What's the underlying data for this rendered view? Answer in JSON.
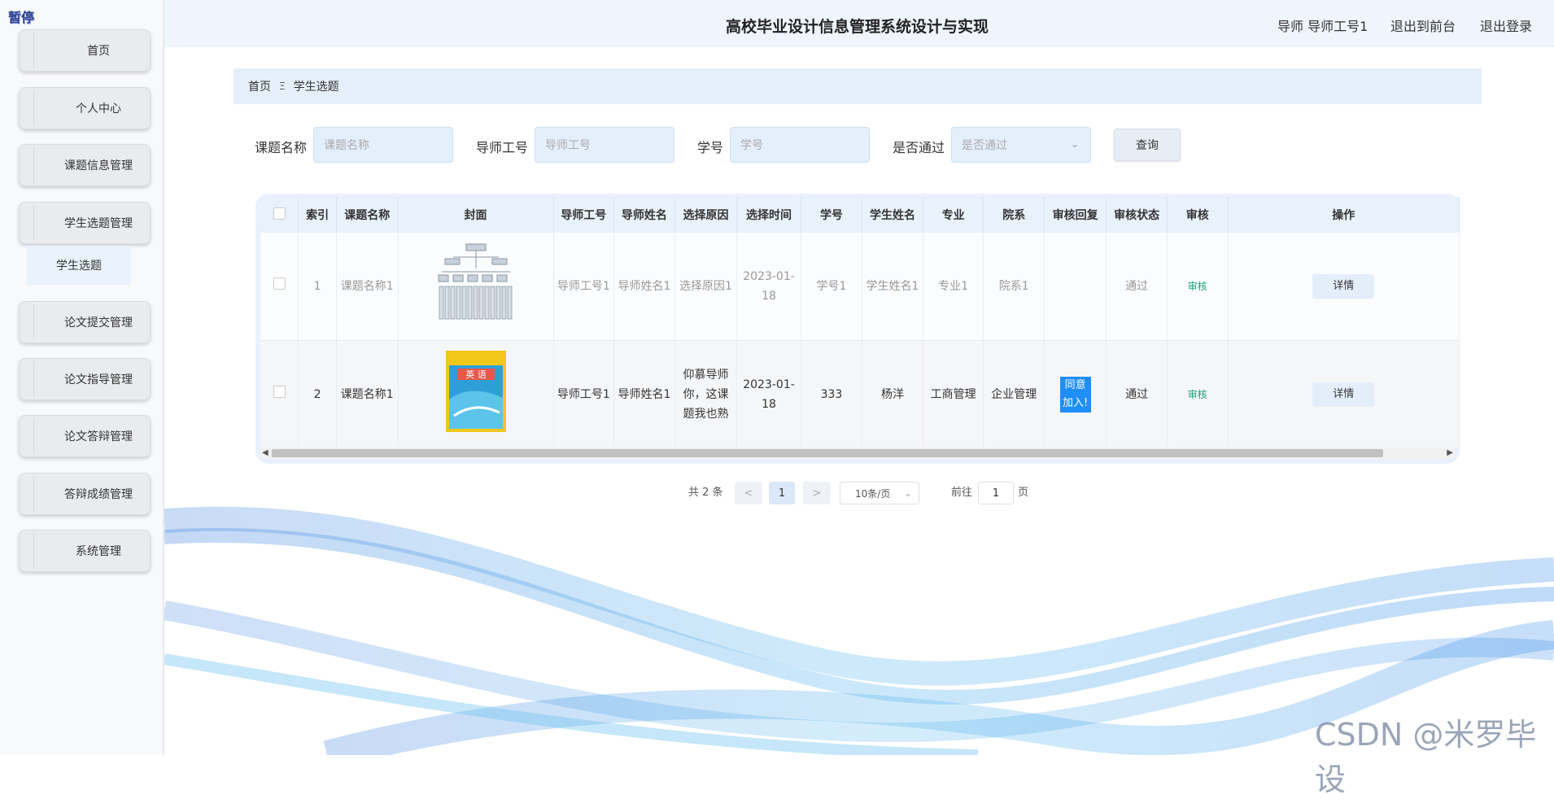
{
  "sidebar": {
    "logo": "暂停",
    "items": [
      {
        "label": "首页"
      },
      {
        "label": "个人中心"
      },
      {
        "label": "课题信息管理"
      },
      {
        "label": "学生选题管理"
      },
      {
        "label": "论文提交管理"
      },
      {
        "label": "论文指导管理"
      },
      {
        "label": "论文答辩管理"
      },
      {
        "label": "答辩成绩管理"
      },
      {
        "label": "系统管理"
      }
    ],
    "sub_item": "学生选题"
  },
  "header": {
    "title": "高校毕业设计信息管理系统设计与实现",
    "user": "导师 导师工号1",
    "to_front": "退出到前台",
    "logout": "退出登录"
  },
  "breadcrumb": {
    "home": "首页",
    "sep": "Ξ",
    "current": "学生选题"
  },
  "search": {
    "topic_label": "课题名称",
    "topic_placeholder": "课题名称",
    "teacher_id_label": "导师工号",
    "teacher_id_placeholder": "导师工号",
    "student_id_label": "学号",
    "student_id_placeholder": "学号",
    "passed_label": "是否通过",
    "passed_placeholder": "是否通过",
    "query_button": "查询"
  },
  "table": {
    "headers": [
      "索引",
      "课题名称",
      "封面",
      "导师工号",
      "导师姓名",
      "选择原因",
      "选择时间",
      "学号",
      "学生姓名",
      "专业",
      "院系",
      "审核回复",
      "审核状态",
      "审核",
      "操作"
    ],
    "rows": [
      {
        "index": "1",
        "topic": "课题名称1",
        "teacher_id": "导师工号1",
        "teacher_name": "导师姓名1",
        "reason": "选择原因1",
        "time": "2023-01-18",
        "student_id": "学号1",
        "student_name": "学生姓名1",
        "major": "专业1",
        "dept": "院系1",
        "reply": "",
        "status": "通过",
        "audit": "审核",
        "action": "详情"
      },
      {
        "index": "2",
        "topic": "课题名称1",
        "teacher_id": "导师工号1",
        "teacher_name": "导师姓名1",
        "reason": "仰慕导师你，这课题我也熟",
        "time": "2023-01-18",
        "student_id": "333",
        "student_name": "杨洋",
        "major": "工商管理",
        "dept": "企业管理",
        "reply": "同意加入!",
        "status": "通过",
        "audit": "审核",
        "action": "详情"
      }
    ]
  },
  "pagination": {
    "total": "共 2 条",
    "prev": "<",
    "page": "1",
    "next": ">",
    "page_size": "10条/页",
    "goto_prefix": "前往",
    "goto_value": "1",
    "goto_suffix": "页"
  },
  "watermark": "CSDN @米罗毕设",
  "colors": {
    "header_bg": "#eef5fd",
    "accent_blue": "#1e8ff7",
    "audit_green": "#1aa37a"
  }
}
